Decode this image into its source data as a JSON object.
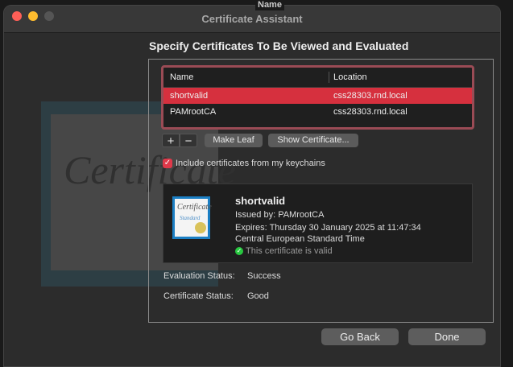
{
  "window": {
    "title": "Certificate Assistant"
  },
  "background_window": {
    "column_header": "Name"
  },
  "art": {
    "text": "Certificate"
  },
  "heading": "Specify Certificates To Be Viewed and Evaluated",
  "table": {
    "columns": [
      "Name",
      "Location"
    ],
    "rows": [
      {
        "name": "shortvalid",
        "location": "css28303.rnd.local",
        "selected": true
      },
      {
        "name": "PAMrootCA",
        "location": "css28303.rnd.local",
        "selected": false
      }
    ]
  },
  "toolbar": {
    "add": "+",
    "remove": "−",
    "make_leaf": "Make Leaf",
    "show_certificate": "Show Certificate..."
  },
  "include_keychains": {
    "label": "Include certificates from my keychains",
    "checked": true
  },
  "cert": {
    "name": "shortvalid",
    "issued_by": "Issued by: PAMrootCA",
    "expires": "Expires: Thursday 30 January 2025 at 11:47:34",
    "timezone": "Central European Standard Time",
    "valid": "This certificate is valid",
    "icon_text1": "Certificate",
    "icon_text2": "Standard"
  },
  "status": {
    "evaluation_label": "Evaluation Status:",
    "evaluation_value": "Success",
    "certificate_label": "Certificate Status:",
    "certificate_value": "Good"
  },
  "footer": {
    "go_back": "Go Back",
    "done": "Done"
  },
  "colors": {
    "selection": "#d6303e",
    "accent": "#e0394a",
    "valid": "#28c840"
  }
}
